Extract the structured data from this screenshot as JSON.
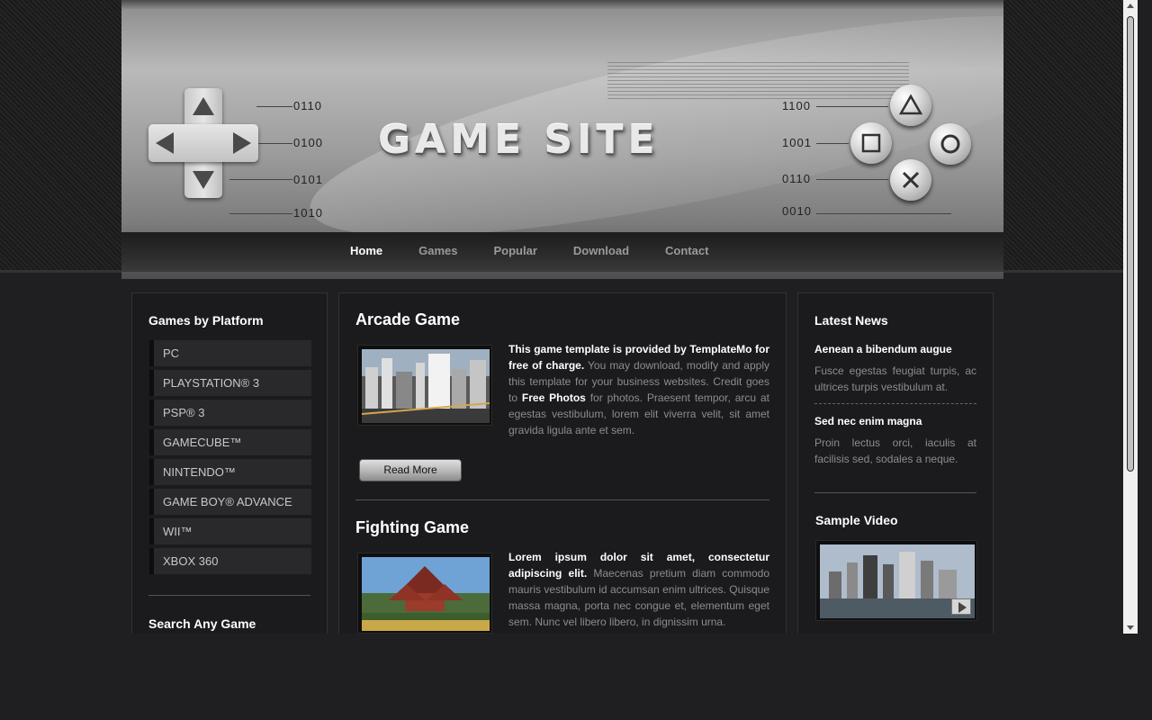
{
  "header": {
    "logo": "GAME SITE",
    "left_codes": [
      "0110",
      "0100",
      "0101",
      "1010"
    ],
    "right_codes": [
      "1100",
      "1001",
      "0110",
      "0010"
    ],
    "dpad_icon": "dpad-icon",
    "face_buttons": [
      "triangle-icon",
      "square-icon",
      "circle-icon",
      "cross-icon"
    ]
  },
  "nav": {
    "items": [
      {
        "label": "Home",
        "active": true
      },
      {
        "label": "Games"
      },
      {
        "label": "Popular"
      },
      {
        "label": "Download"
      },
      {
        "label": "Contact"
      }
    ]
  },
  "left": {
    "platforms_title": "Games by Platform",
    "platforms": [
      "PC",
      "PLAYSTATION® 3",
      "PSP® 3",
      "GAMECUBE™",
      "NINTENDO™",
      "GAME BOY® ADVANCE",
      "WII™",
      "XBOX 360"
    ],
    "search_title": "Search Any Game"
  },
  "main": {
    "posts": [
      {
        "title": "Arcade Game",
        "lead": "This game template is provided by TemplateMo for free of charge.",
        "text1": " You may download, modify and apply this template for your business websites. Credit goes to ",
        "link": "Free Photos",
        "text2": " for photos. Praesent tempor, arcu at egestas vestibulum, lorem elit viverra velit, sit amet gravida ligula ante et sem.",
        "button": "Read More"
      },
      {
        "title": "Fighting Game",
        "lead": "Lorem ipsum dolor sit amet, consectetur adipiscing elit.",
        "text1": " Maecenas pretium diam commodo mauris vestibulum id accumsan enim ultrices. Quisque massa magna, porta nec congue et, elementum eget sem. Nunc vel libero libero, in dignissim urna.",
        "link": "",
        "text2": ""
      }
    ]
  },
  "right": {
    "news_title": "Latest News",
    "news": [
      {
        "title": "Aenean a bibendum augue",
        "text": "Fusce egestas feugiat turpis, ac ultrices turpis vestibulum at."
      },
      {
        "title": "Sed nec enim magna",
        "text": "Proin lectus orci, iaculis at facilisis sed, sodales a neque."
      }
    ],
    "video_title": "Sample Video"
  },
  "colors": {
    "background": "#1f1e20",
    "panel": "#1b1a1c",
    "nav_active": "#ffffff",
    "nav_inactive": "#9a9a9a"
  }
}
